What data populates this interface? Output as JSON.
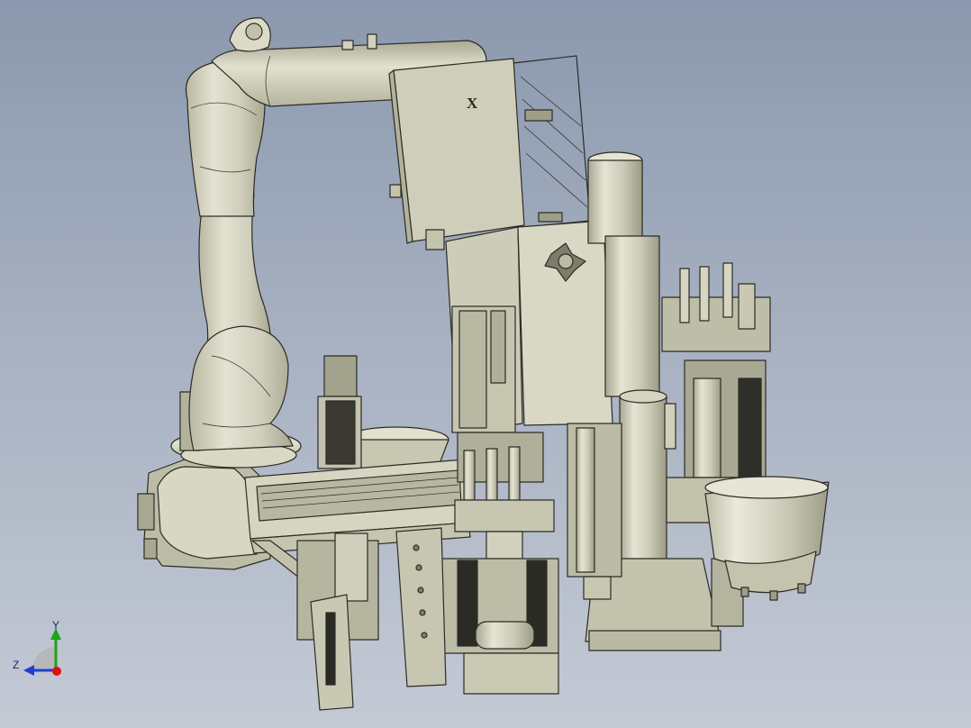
{
  "viewport": {
    "background_top": "#8b98ad",
    "background_bottom": "#c4cad5",
    "model_color": "#c9c8b4"
  },
  "model": {
    "panel_mark": "X"
  },
  "triad": {
    "y_label": "Y",
    "z_label": "Z",
    "y_color": "#1aa51a",
    "z_color": "#1f3fd0",
    "x_color": "#e01010"
  }
}
